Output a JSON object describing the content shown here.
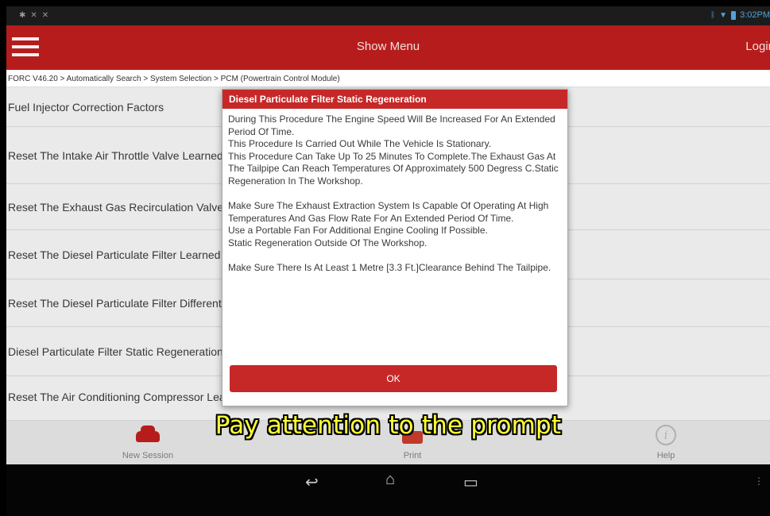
{
  "status_bar": {
    "time": "3:02PM"
  },
  "header": {
    "title": "Show Menu",
    "login_label": "Login"
  },
  "breadcrumb": "FORC V46.20 > Automatically Search > System Selection > PCM (Powertrain Control Module)",
  "list": {
    "items": [
      "Fuel Injector Correction Factors",
      "Reset The Intake Air Throttle Valve Learned Values",
      "Reset The Exhaust Gas Recirculation Valve Learned Values",
      "Reset The Diesel Particulate Filter Learned Values",
      "Reset The Diesel Particulate Filter Differential Pressure Sensor",
      "Diesel Particulate Filter Static Regeneration",
      "Reset The Air Conditioning Compressor Learned Values"
    ]
  },
  "dialog": {
    "title": "Diesel Particulate Filter Static Regeneration",
    "body": "During This Procedure The Engine Speed Will Be Increased For An Extended Period Of Time.\nThis Procedure Is Carried Out While The Vehicle Is Stationary.\nThis Procedure Can Take Up To 25 Minutes To Complete.The Exhaust Gas At The Tailpipe Can Reach Temperatures Of Approximately 500 Degress C.Static Regeneration In The Workshop.\n\nMake Sure The Exhaust Extraction System Is Capable Of Operating At High Temperatures And Gas Flow Rate For An Extended Period Of Time.\nUse a Portable Fan For Additional Engine Cooling If Possible.\nStatic Regeneration Outside Of The Workshop.\n\nMake Sure There Is At Least 1 Metre [3.3 Ft.]Clearance Behind The Tailpipe.",
    "ok_label": "OK"
  },
  "toolbar": {
    "new_session_label": "New Session",
    "print_label": "Print",
    "help_label": "Help"
  },
  "caption": "Pay attention to the prompt",
  "colors": {
    "brand_red": "#b71c1c",
    "caption_yellow": "#ffff33"
  },
  "icons": [
    "car-icon",
    "printer-icon",
    "help-icon",
    "back-icon",
    "home-icon",
    "recents-icon",
    "menu-icon"
  ]
}
